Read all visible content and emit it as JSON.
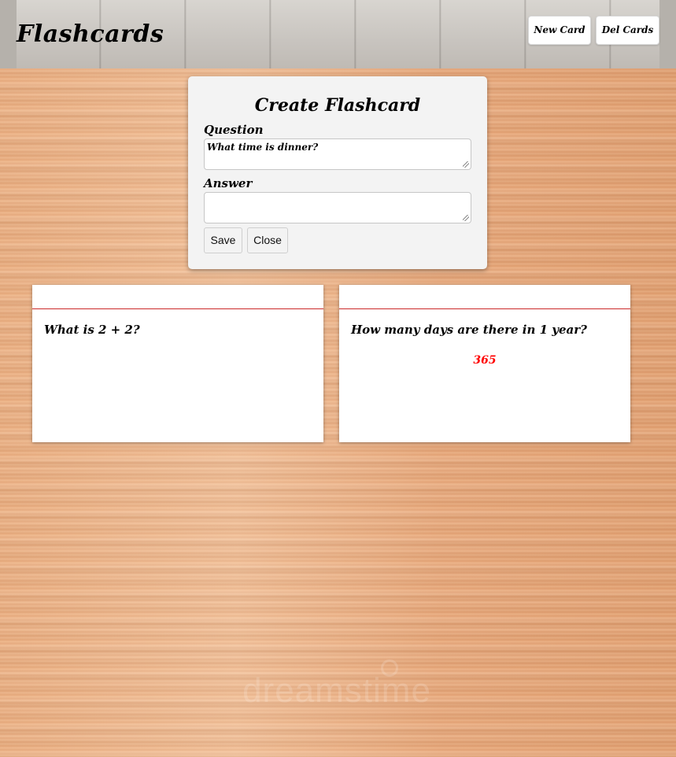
{
  "header": {
    "title": "Flashcards",
    "new_card_label": "New Card",
    "del_cards_label": "Del Cards"
  },
  "create_form": {
    "title": "Create Flashcard",
    "question_label": "Question",
    "question_value": "What time is dinner?",
    "answer_label": "Answer",
    "answer_value": "",
    "save_label": "Save",
    "close_label": "Close"
  },
  "cards": [
    {
      "question": "What is 2 + 2?",
      "answer": ""
    },
    {
      "question": "How many days are there in 1 year?",
      "answer": "365"
    }
  ],
  "watermark": "dreamstime",
  "colors": {
    "answer_text": "#ff0000",
    "card_rule": "#cc2a2a",
    "panel_background": "#f3f3f3"
  }
}
